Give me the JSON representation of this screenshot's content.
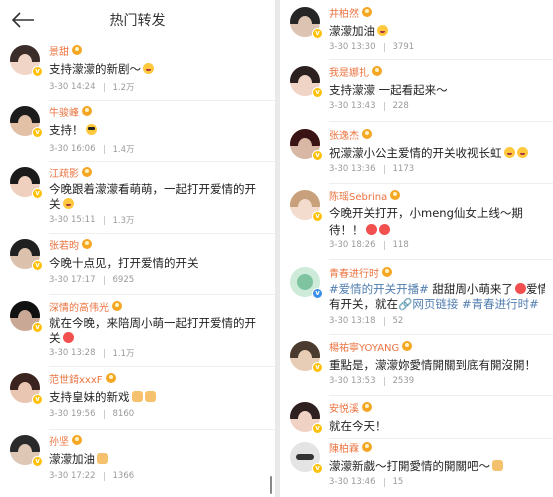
{
  "header": {
    "title": "热门转发"
  },
  "left": [
    {
      "name": "景甜",
      "content": "支持濛濛的新剧～",
      "time": "3-30 14:24",
      "likes": "1.2万",
      "avatar": [
        "#3a2d2a",
        "#f1d6c8"
      ]
    },
    {
      "name": "牛骏峰",
      "content": "支持！",
      "time": "3-30 16:06",
      "likes": "1.4万",
      "avatar": [
        "#1c1c1c",
        "#e2c0a6"
      ]
    },
    {
      "name": "江疏影",
      "content": "今晚跟着濛濛看萌萌，一起打开爱情的开关",
      "time": "3-30 15:11",
      "likes": "1.3万",
      "avatar": [
        "#1b1b1b",
        "#efcfbd"
      ]
    },
    {
      "name": "张若昀",
      "content": "今晚十点见，打开爱情的开关",
      "time": "3-30 17:17",
      "likes": "6925",
      "avatar": [
        "#202020",
        "#dcc1ad"
      ]
    },
    {
      "name": "深情的高伟光",
      "content": "就在今晚，来陪周小萌一起打开爱情的开关",
      "time": "3-30 13:28",
      "likes": "1.1万",
      "avatar": [
        "#111111",
        "#c9a995"
      ]
    },
    {
      "name": "范世錡xxxF",
      "content": "支持皇妹的新戏",
      "time": "3-30 19:56",
      "likes": "8160",
      "avatar": [
        "#3b2420",
        "#e9c6b1"
      ]
    },
    {
      "name": "孙坚",
      "content": "濛濛加油",
      "time": "3-30 17:22",
      "likes": "1366",
      "avatar": [
        "#2a2a2a",
        "#dfc7b5"
      ]
    }
  ],
  "right": [
    {
      "name": "井柏然",
      "content": "濛濛加油",
      "time": "3-30 13:30",
      "likes": "3791",
      "avatar": [
        "#262626",
        "#ddc3b1"
      ]
    },
    {
      "name": "我是娜扎",
      "content": "支持濛濛 一起看起来～",
      "time": "3-30 13:43",
      "likes": "228",
      "avatar": [
        "#2b2120",
        "#f0d4c5"
      ]
    },
    {
      "name": "张逸杰",
      "content": "祝濛濛小公主爱情的开关收视长虹",
      "time": "3-30 13:36",
      "likes": "1173",
      "avatar": [
        "#3a1414",
        "#d8b8a4"
      ]
    },
    {
      "name": "陈瑶Sebrina",
      "content_1": "今晚开关打开，小meng仙女上线～期",
      "content_2": "待！！",
      "time": "3-30 18:26",
      "likes": "118",
      "avatar": [
        "#c8a17c",
        "#f3dccd"
      ]
    },
    {
      "name": "青春进行时",
      "hashtag_1": "#爱情的开关开播#",
      "text_1": " 甜甜周小萌来了",
      "text_2": "爱情",
      "text_3": "有开关，就在",
      "link": "网页链接",
      "hashtag_2": "#青春进行时#",
      "time": "3-30 13:18",
      "likes": "52",
      "avatar": [
        "#cdebd8",
        "#7fc4a0"
      ]
    },
    {
      "name": "楊祐寧YOYANG",
      "content": "重點是，濛濛妳愛情開關到底有開沒開！",
      "time": "3-30 13:53",
      "likes": "2539",
      "avatar": [
        "#4a3b2e",
        "#e8cdb6"
      ]
    },
    {
      "name": "安悦溪",
      "content": "就在今天！",
      "time": "",
      "likes": "",
      "avatar": [
        "#2e2020",
        "#f0d2c4"
      ]
    },
    {
      "name": "陳柏霖",
      "content": "濛濛新戲～打開愛情的開關吧～",
      "time": "3-30 13:46",
      "likes": "15",
      "avatar": [
        "#e4e4e4",
        "#333333"
      ]
    }
  ]
}
